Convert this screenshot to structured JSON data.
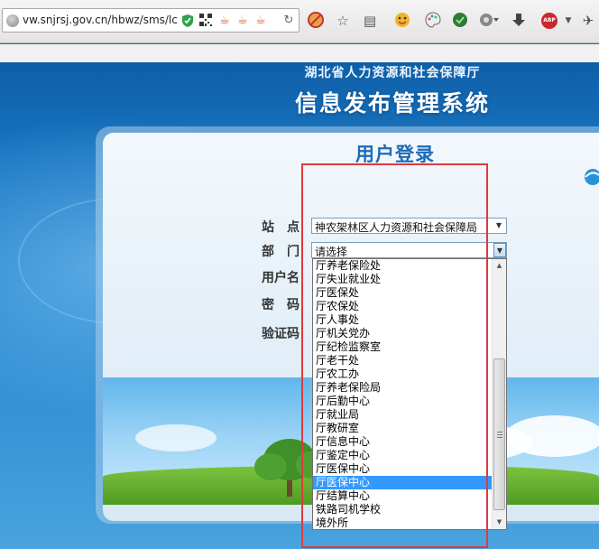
{
  "browser": {
    "url": "vw.snjrsj.gov.cn/hbwz/sms/lc",
    "icons": [
      "globe-icon",
      "shield-check-icon",
      "qr-code-icon",
      "java-icon",
      "java-icon",
      "java-icon",
      "reload-icon",
      "block-icon",
      "star-icon",
      "reading-list-icon",
      "emoji-icon",
      "palette-icon",
      "extension-icon",
      "extension-icon",
      "download-icon",
      "adblock-icon",
      "menu-icon"
    ],
    "adblock_label": "ABP"
  },
  "header": {
    "org_name": "湖北省人力资源和社会保障厅",
    "system_name": "信息发布管理系统"
  },
  "login": {
    "title": "用户登录",
    "site_label": "站　点",
    "site_value": "神农架林区人力资源和社会保障局",
    "dept_label": "部　门",
    "dept_value": "请选择",
    "username_label": "用户名",
    "password_label": "密　码",
    "captcha_label": "验证码"
  },
  "dropdown": {
    "options": [
      "厅养老保险处",
      "厅失业就业处",
      "厅医保处",
      "厅农保处",
      "厅人事处",
      "厅机关党办",
      "厅纪检监察室",
      "厅老干处",
      "厅农工办",
      "厅养老保险局",
      "厅后勤中心",
      "厅就业局",
      "厅教研室",
      "厅信息中心",
      "厅鉴定中心",
      "厅医保中心",
      "厅医保中心",
      "厅结算中心",
      "铁路司机学校",
      "境外所"
    ],
    "selected_index": 16
  },
  "colors": {
    "accent": "#1c6bb8",
    "selection": "#3399ff",
    "highlight_box": "#e0393e"
  }
}
